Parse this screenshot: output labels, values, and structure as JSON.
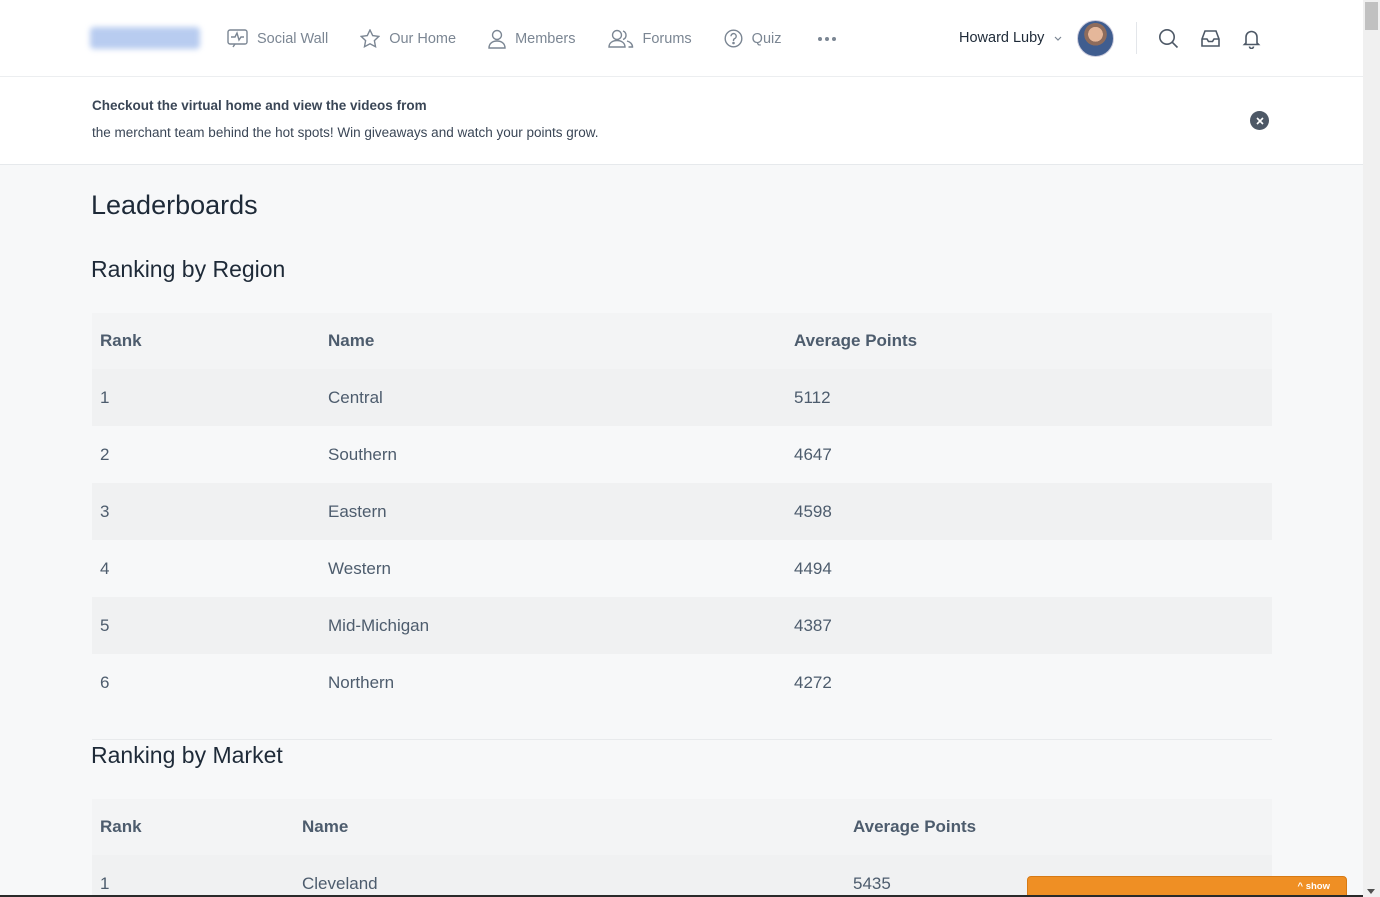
{
  "header": {
    "logo_text": "Meijer 2020",
    "nav": [
      {
        "label": "Social Wall",
        "icon": "activity-icon"
      },
      {
        "label": "Our Home",
        "icon": "star-icon"
      },
      {
        "label": "Members",
        "icon": "user-icon"
      },
      {
        "label": "Forums",
        "icon": "users-icon"
      },
      {
        "label": "Quiz",
        "icon": "help-circle-icon"
      }
    ],
    "user_name": "Howard Luby"
  },
  "notice": {
    "title": "Checkout the virtual home and view the videos from",
    "text": "the merchant team behind the hot spots!  Win giveaways and watch your points grow."
  },
  "page_title": "Leaderboards",
  "region": {
    "title": "Ranking by Region",
    "headers": [
      "Rank",
      "Name",
      "Average Points"
    ],
    "rows": [
      [
        "1",
        "Central",
        "5112"
      ],
      [
        "2",
        "Southern",
        "4647"
      ],
      [
        "3",
        "Eastern",
        "4598"
      ],
      [
        "4",
        "Western",
        "4494"
      ],
      [
        "5",
        "Mid-Michigan",
        "4387"
      ],
      [
        "6",
        "Northern",
        "4272"
      ]
    ]
  },
  "market": {
    "title": "Ranking by Market",
    "headers": [
      "Rank",
      "Name",
      "Average Points"
    ],
    "rows": [
      [
        "1",
        "Cleveland",
        "5435"
      ]
    ]
  },
  "widget": {
    "show_label": "^ show"
  },
  "colors": {
    "accent_orange": "#ef8f24",
    "text_dark": "#1e2a38",
    "text_muted": "#7b8693"
  }
}
